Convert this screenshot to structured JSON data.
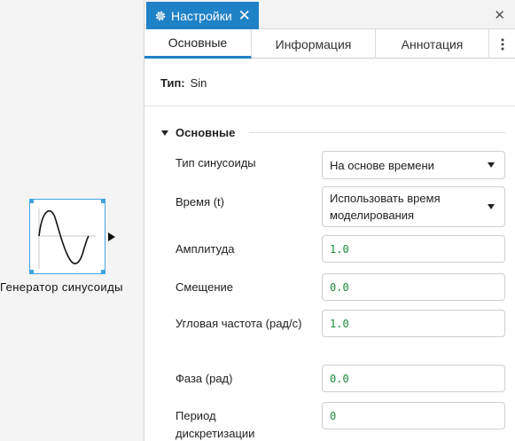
{
  "canvas": {
    "block_label": "Генератор синусоиды"
  },
  "panel": {
    "title": "Настройки",
    "tabs": [
      {
        "label": "Основные"
      },
      {
        "label": "Информация"
      },
      {
        "label": "Аннотация"
      }
    ],
    "type_label": "Тип:",
    "type_value": "Sin",
    "section_title": "Основные",
    "fields": {
      "sine_type": {
        "label": "Тип синусоиды",
        "value": "На основе времени"
      },
      "time": {
        "label": "Время (t)",
        "value": "Использовать время моделирования"
      },
      "amplitude": {
        "label": "Амплитуда",
        "value": "1.0"
      },
      "bias": {
        "label": "Смещение",
        "value": "0.0"
      },
      "frequency": {
        "label": "Угловая частота (рад/с)",
        "value": "1.0"
      },
      "phase": {
        "label": "Фаза (рад)",
        "value": "0.0"
      },
      "sample_time": {
        "label": "Период дискретизации",
        "value": "0"
      }
    }
  },
  "colors": {
    "accent": "#1f82c7",
    "selection": "#41a4e0",
    "value_text": "#1a8c3c"
  },
  "icons": {
    "settings": "gear-icon",
    "close_tab": "close-icon",
    "close_panel": "close-icon",
    "more": "vertical-dots-icon",
    "section_toggle": "triangle-down-icon",
    "dropdown": "caret-down-icon"
  }
}
